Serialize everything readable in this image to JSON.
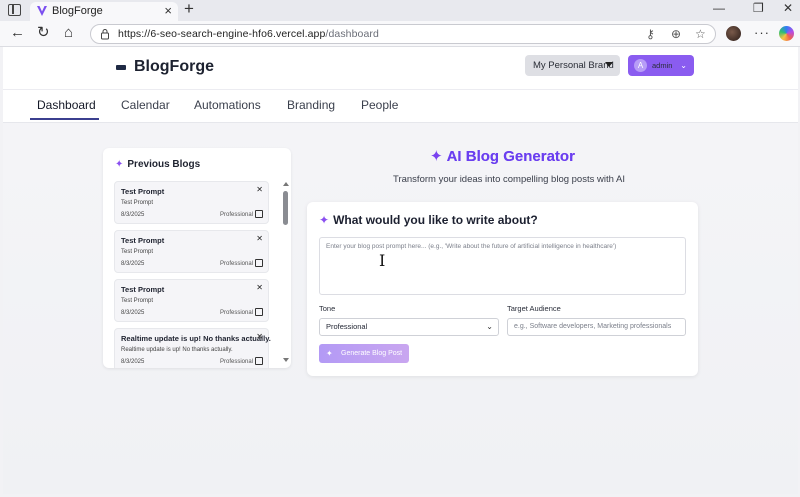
{
  "browser": {
    "tab_title": "BlogForge",
    "url_host": "https://6-seo-search-engine-hfo6.vercel.app",
    "url_path": "/dashboard"
  },
  "header": {
    "logo_text": "BlogForge",
    "brand_select": "My Personal Brand",
    "user_initial": "A",
    "user_name": "admin"
  },
  "nav": {
    "items": [
      "Dashboard",
      "Calendar",
      "Automations",
      "Branding",
      "People"
    ],
    "active": "Dashboard"
  },
  "sidebar": {
    "title": "Previous Blogs",
    "blogs": [
      {
        "title": "Test Prompt",
        "subtitle": "Test Prompt",
        "date": "8/3/2025",
        "tone": "Professional"
      },
      {
        "title": "Test Prompt",
        "subtitle": "Test Prompt",
        "date": "8/3/2025",
        "tone": "Professional"
      },
      {
        "title": "Test Prompt",
        "subtitle": "Test Prompt",
        "date": "8/3/2025",
        "tone": "Professional"
      },
      {
        "title": "Realtime update is up! No thanks actually.",
        "subtitle": "Realtime update is up! No thanks actually.",
        "date": "8/3/2025",
        "tone": "Professional"
      }
    ]
  },
  "main": {
    "heading": "AI Blog Generator",
    "subheading": "Transform your ideas into compelling blog posts with AI",
    "panel_title": "What would you like to write about?",
    "prompt_placeholder": "Enter your blog post prompt here... (e.g., 'Write about the future of artificial intelligence in healthcare')",
    "tone_label": "Tone",
    "tone_value": "Professional",
    "audience_label": "Target Audience",
    "audience_placeholder": "e.g., Software developers, Marketing professionals",
    "generate_label": "Generate Blog Post"
  },
  "colors": {
    "accent": "#8a5cf0",
    "heading_gradient_start": "#6a3ff0",
    "nav_underline": "#3b3f8f"
  }
}
